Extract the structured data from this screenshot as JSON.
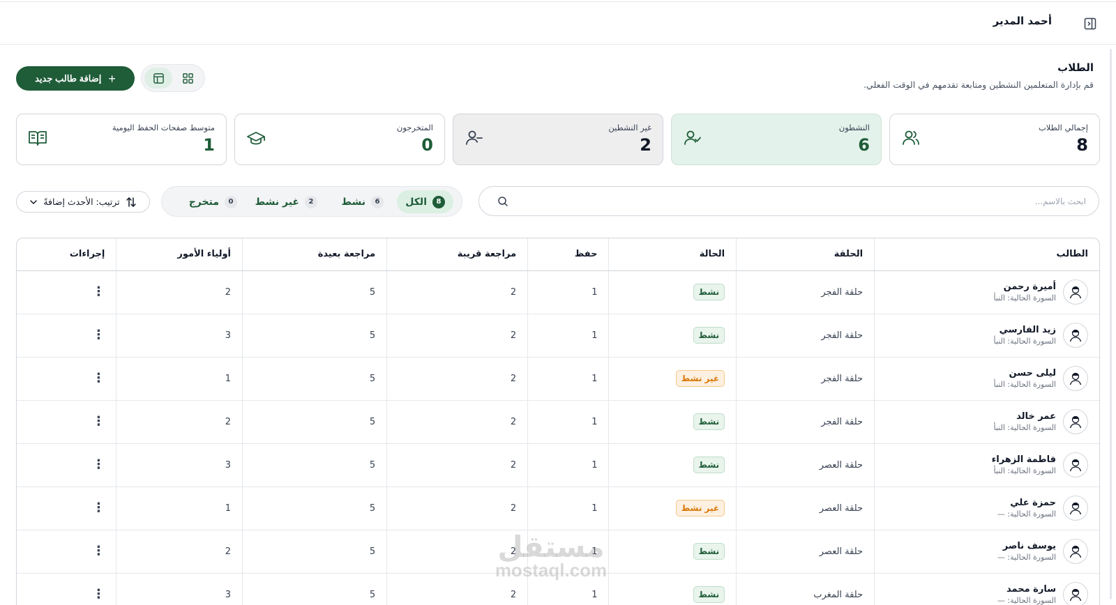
{
  "topbar": {
    "user_name": "أحمد المدير",
    "panel_icon": "sidebar-toggle-icon"
  },
  "header": {
    "title": "الطلاب",
    "subtitle": "قم بإدارة المتعلمين النشطين ومتابعة تقدمهم في الوقت الفعلي.",
    "add_button_label": "إضافة طالب جديد"
  },
  "stats": [
    {
      "label": "إجمالي الطلاب",
      "value": "8",
      "icon": "users-icon"
    },
    {
      "label": "النشطون",
      "value": "6",
      "icon": "user-check-icon"
    },
    {
      "label": "غير النشطين",
      "value": "2",
      "icon": "user-minus-icon"
    },
    {
      "label": "المتخرجون",
      "value": "0",
      "icon": "graduation-cap-icon"
    },
    {
      "label": "متوسط صفحات الحفظ اليومية",
      "value": "1",
      "icon": "book-open-icon"
    }
  ],
  "search": {
    "placeholder": "ابحث بالاسم..."
  },
  "filters": [
    {
      "label": "الكل",
      "count": "8"
    },
    {
      "label": "نشط",
      "count": "6"
    },
    {
      "label": "غير نشط",
      "count": "2"
    },
    {
      "label": "متخرج",
      "count": "0"
    }
  ],
  "sort": {
    "label": "ترتيب: الأحدث إضافةً"
  },
  "table": {
    "headers": [
      "الطالب",
      "الحلقة",
      "الحالة",
      "حفظ",
      "مراجعة قريبة",
      "مراجعة بعيدة",
      "أولياء الأمور",
      "إجراءات"
    ],
    "rows": [
      {
        "name": "أميرة رحمن",
        "sura": "السورة الحالية: النبأ",
        "halaqa": "حلقة الفجر",
        "status": "نشط",
        "hifz": "1",
        "near": "2",
        "far": "5",
        "guardians": "2",
        "actions": "⋮"
      },
      {
        "name": "زيد الفارسي",
        "sura": "السورة الحالية: النبأ",
        "halaqa": "حلقة الفجر",
        "status": "نشط",
        "hifz": "1",
        "near": "2",
        "far": "5",
        "guardians": "3",
        "actions": "⋮"
      },
      {
        "name": "ليلى حسن",
        "sura": "السورة الحالية: النبأ",
        "halaqa": "حلقة الفجر",
        "status": "غير نشط",
        "hifz": "1",
        "near": "2",
        "far": "5",
        "guardians": "1",
        "actions": "⋮"
      },
      {
        "name": "عمر خالد",
        "sura": "السورة الحالية: النبأ",
        "halaqa": "حلقة الفجر",
        "status": "نشط",
        "hifz": "1",
        "near": "2",
        "far": "5",
        "guardians": "2",
        "actions": "⋮"
      },
      {
        "name": "فاطمة الزهراء",
        "sura": "السورة الحالية: النبأ",
        "halaqa": "حلقة العصر",
        "status": "نشط",
        "hifz": "1",
        "near": "2",
        "far": "5",
        "guardians": "3",
        "actions": "⋮"
      },
      {
        "name": "حمزة علي",
        "sura": "السورة الحالية: —",
        "halaqa": "حلقة العصر",
        "status": "غير نشط",
        "hifz": "1",
        "near": "2",
        "far": "5",
        "guardians": "1",
        "actions": "⋮"
      },
      {
        "name": "يوسف ناصر",
        "sura": "السورة الحالية: —",
        "halaqa": "حلقة العصر",
        "status": "نشط",
        "hifz": "1",
        "near": "2",
        "far": "5",
        "guardians": "2",
        "actions": "⋮"
      },
      {
        "name": "سارة محمد",
        "sura": "السورة الحالية: —",
        "halaqa": "حلقة المغرب",
        "status": "نشط",
        "hifz": "1",
        "near": "2",
        "far": "5",
        "guardians": "3",
        "actions": "⋮"
      }
    ]
  },
  "watermark": {
    "arabic": "مستقل",
    "latin": "mostaql.com"
  },
  "colors": {
    "primary": "#1f5c38",
    "active_card_bg": "#e3f2ea",
    "inactive_badge": "#d97706"
  }
}
